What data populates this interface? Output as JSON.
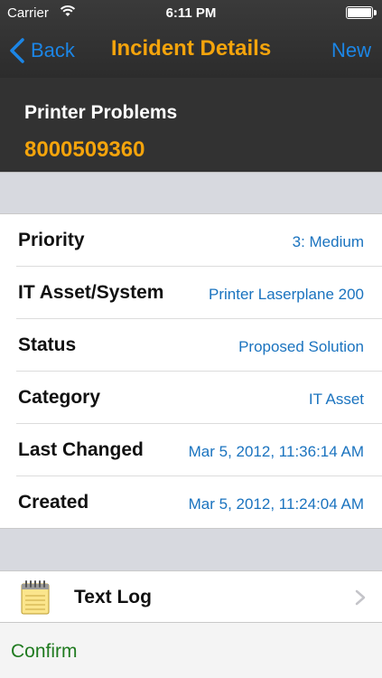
{
  "status_bar": {
    "carrier": "Carrier",
    "time": "6:11 PM"
  },
  "nav": {
    "back_label": "Back",
    "title": "Incident Details",
    "right_label": "New"
  },
  "incident": {
    "name": "Printer Problems",
    "number": "8000509360"
  },
  "details": [
    {
      "label": "Priority",
      "value": "3: Medium"
    },
    {
      "label": "IT Asset/System",
      "value": "Printer Laserplane 200"
    },
    {
      "label": "Status",
      "value": "Proposed Solution"
    },
    {
      "label": "Category",
      "value": "IT Asset"
    },
    {
      "label": "Last Changed",
      "value": "Mar 5, 2012, 11:36:14 AM"
    },
    {
      "label": "Created",
      "value": "Mar 5, 2012, 11:24:04 AM"
    }
  ],
  "text_log": {
    "label": "Text Log",
    "icon": "notepad-icon"
  },
  "footer": {
    "confirm_label": "Confirm"
  },
  "colors": {
    "accent_orange": "#f4a40c",
    "link_blue": "#1c86e6",
    "value_blue": "#1a73bf",
    "confirm_green": "#1f7a1f"
  }
}
